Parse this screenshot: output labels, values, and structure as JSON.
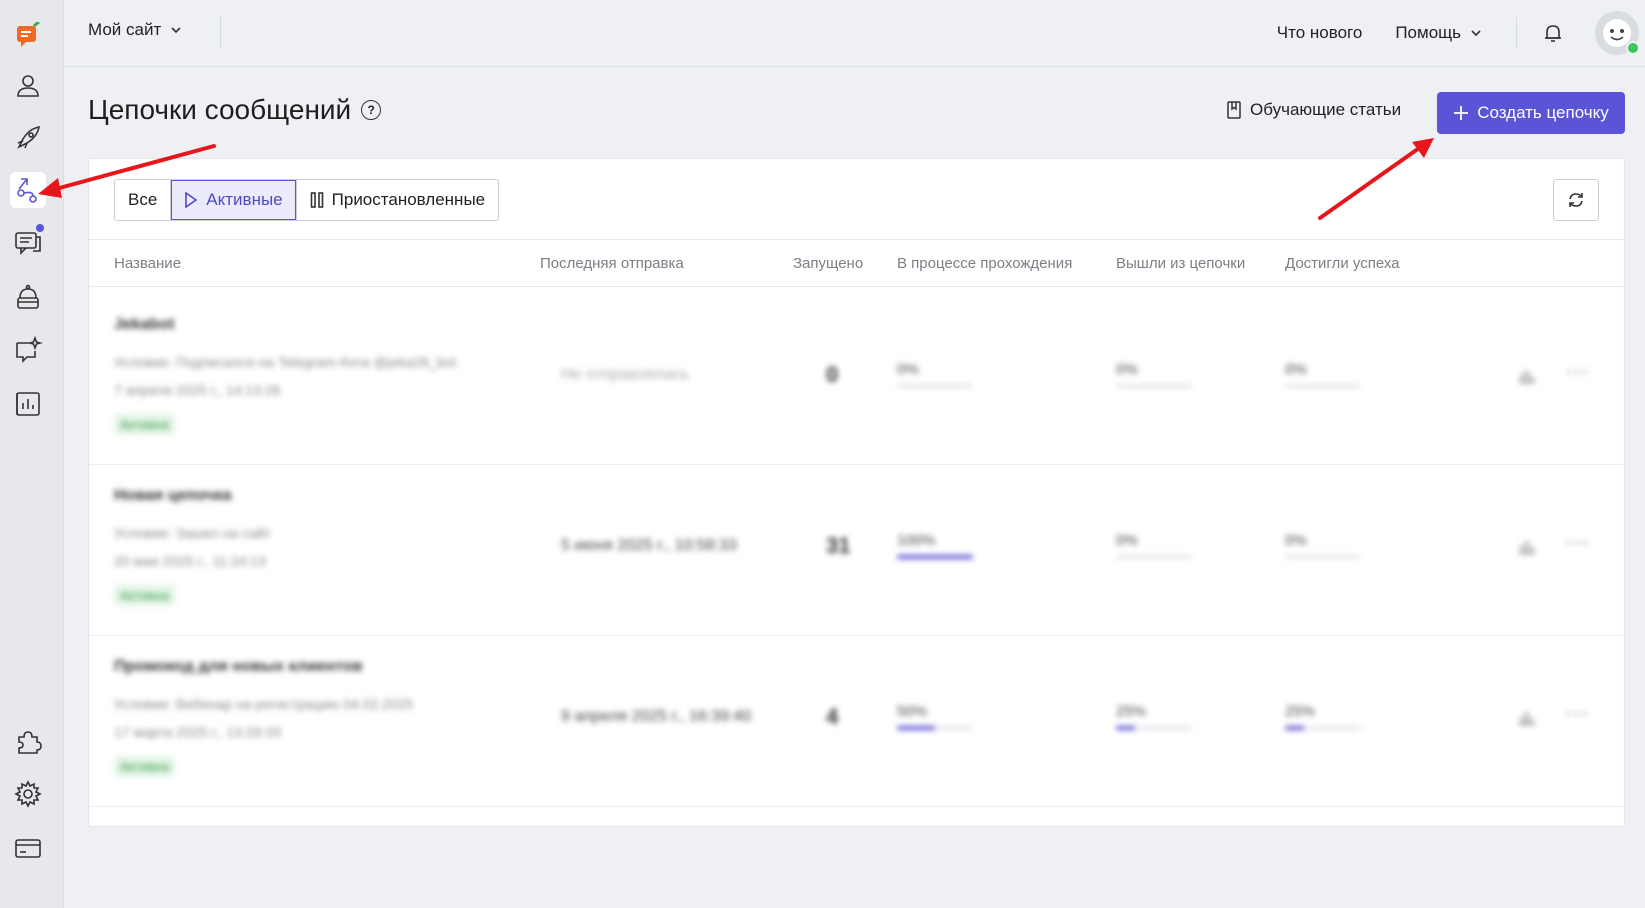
{
  "topbar": {
    "site_select": "Мой сайт",
    "whats_new": "Что нового",
    "help": "Помощь"
  },
  "sidebar": {
    "items": [
      {
        "icon": "logo-icon"
      },
      {
        "icon": "contacts-icon"
      },
      {
        "icon": "campaigns-icon"
      },
      {
        "icon": "chains-icon",
        "active": true
      },
      {
        "icon": "chat-icon",
        "badge": true
      },
      {
        "icon": "bot-icon"
      },
      {
        "icon": "ai-icon"
      },
      {
        "icon": "reports-icon"
      },
      {
        "icon": "integrations-icon"
      },
      {
        "icon": "settings-icon"
      },
      {
        "icon": "billing-icon"
      }
    ]
  },
  "page": {
    "title": "Цепочки сообщений",
    "articles_label": "Обучающие статьи",
    "create_label": "Создать цепочку"
  },
  "filters": {
    "all": "Все",
    "active": "Активные",
    "paused": "Приостановленные",
    "selected": "Активные"
  },
  "table": {
    "columns": [
      "Название",
      "Последняя отправка",
      "Запущено",
      "В процессе прохождения",
      "Вышли из цепочки",
      "Достигли успеха"
    ],
    "rows": [
      {
        "name": "Jekabot",
        "condition": "Условие: Подписался на Telegram-бота @jeka28_bot",
        "created": "7 апреля 2025 г., 14:13:26",
        "status": "Активна",
        "last_sent": "Не отправлялась",
        "launched": "0",
        "in_progress": "0%",
        "exited": "0%",
        "success": "0%"
      },
      {
        "name": "Новая цепочка",
        "condition": "Условие: Зашел на сайт",
        "created": "20 мая 2025 г., 11:24:13",
        "status": "Активна",
        "last_sent": "5 июня 2025 г., 10:58:33",
        "launched": "31",
        "in_progress": "100%",
        "exited": "0%",
        "success": "0%"
      },
      {
        "name": "Промокод для новых клиентов",
        "condition": "Условие: Вебинар на регистрацию 04.02.2025",
        "created": "17 марта 2025 г., 13:29:33",
        "status": "Активна",
        "last_sent": "9 апреля 2025 г., 16:39:40",
        "launched": "4",
        "in_progress": "50%",
        "exited": "25%",
        "success": "25%"
      }
    ]
  },
  "colors": {
    "accent": "#5b54d6",
    "annotation_arrow": "#e8161b"
  }
}
